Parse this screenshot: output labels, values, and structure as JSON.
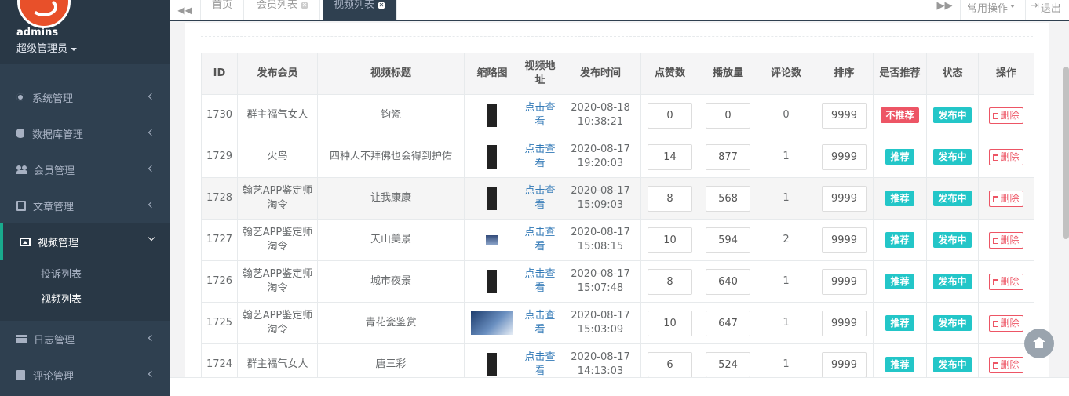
{
  "profile": {
    "name": "admins",
    "role": "超级管理员"
  },
  "menu": [
    {
      "label": "系统管理",
      "icon": "gear-icon"
    },
    {
      "label": "数据库管理",
      "icon": "database-icon"
    },
    {
      "label": "会员管理",
      "icon": "users-icon"
    },
    {
      "label": "文章管理",
      "icon": "document-icon"
    },
    {
      "label": "视频管理",
      "icon": "picture-icon"
    },
    {
      "label": "日志管理",
      "icon": "log-icon"
    },
    {
      "label": "评论管理",
      "icon": "file-icon"
    }
  ],
  "submenu": [
    "投诉列表",
    "视频列表"
  ],
  "tabs": {
    "home": "首页",
    "members": "会员列表",
    "videos": "视频列表"
  },
  "toolbar": {
    "common_ops": "常用操作",
    "logout": "退出"
  },
  "table": {
    "headers": [
      "ID",
      "发布会员",
      "视频标题",
      "缩略图",
      "视频地址",
      "发布时间",
      "点赞数",
      "播放量",
      "评论数",
      "排序",
      "是否推荐",
      "状态",
      "操作"
    ],
    "view_link": "点击查看",
    "delete_label": "删除",
    "rows": [
      {
        "id": "1730",
        "member": "群主福气女人",
        "title": "钧瓷",
        "date": "2020-08-18",
        "time": "10:38:21",
        "likes": "0",
        "plays": "0",
        "comments": "0",
        "sort": "9999",
        "recommend": "不推荐",
        "status": "发布中"
      },
      {
        "id": "1729",
        "member": "火鸟",
        "title": "四种人不拜佛也会得到护佑",
        "date": "2020-08-17",
        "time": "19:20:03",
        "likes": "14",
        "plays": "877",
        "comments": "1",
        "sort": "9999",
        "recommend": "推荐",
        "status": "发布中"
      },
      {
        "id": "1728",
        "member": "翰艺APP鉴定师淘令",
        "title": "让我康康",
        "date": "2020-08-17",
        "time": "15:09:03",
        "likes": "8",
        "plays": "568",
        "comments": "1",
        "sort": "9999",
        "recommend": "推荐",
        "status": "发布中"
      },
      {
        "id": "1727",
        "member": "翰艺APP鉴定师淘令",
        "title": "天山美景",
        "date": "2020-08-17",
        "time": "15:08:15",
        "likes": "10",
        "plays": "594",
        "comments": "2",
        "sort": "9999",
        "recommend": "推荐",
        "status": "发布中"
      },
      {
        "id": "1726",
        "member": "翰艺APP鉴定师淘令",
        "title": "城市夜景",
        "date": "2020-08-17",
        "time": "15:07:48",
        "likes": "8",
        "plays": "640",
        "comments": "1",
        "sort": "9999",
        "recommend": "推荐",
        "status": "发布中"
      },
      {
        "id": "1725",
        "member": "翰艺APP鉴定师淘令",
        "title": "青花瓷鉴赏",
        "date": "2020-08-17",
        "time": "15:03:09",
        "likes": "10",
        "plays": "647",
        "comments": "1",
        "sort": "9999",
        "recommend": "推荐",
        "status": "发布中"
      },
      {
        "id": "1724",
        "member": "群主福气女人",
        "title": "唐三彩",
        "date": "2020-08-17",
        "time": "14:13:03",
        "likes": "6",
        "plays": "524",
        "comments": "1",
        "sort": "9999",
        "recommend": "推荐",
        "status": "发布中"
      }
    ]
  },
  "colors": {
    "sidebar": "#2f4050",
    "accent": "#19aa8d",
    "danger": "#ed5565",
    "info": "#23c6c8"
  }
}
